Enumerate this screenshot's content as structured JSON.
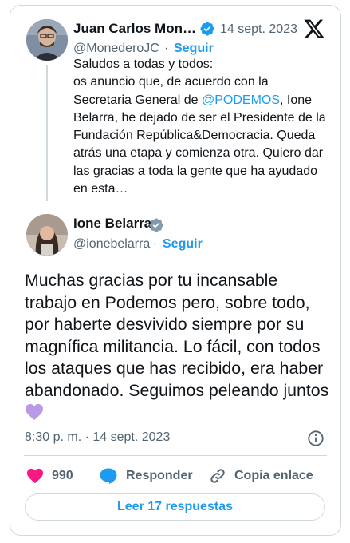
{
  "quoted_tweet": {
    "author_name": "Juan Carlos Mon…",
    "handle": "@MonederoJC",
    "date": "14 sept. 2023",
    "follow_label": "Seguir",
    "separator": "·",
    "text_line1": "Saludos a todas y todos:",
    "text_line2": "os anuncio que, de acuerdo con la",
    "text_line3_pre": "Secretaria General de ",
    "text_mention": "@PODEMOS",
    "text_line3_post": ", Ione",
    "text_rest": "Belarra, he dejado de ser el Presidente de la Fundación República&Democracia. Queda atrás una etapa y comienza otra. Quiero dar las gracias a toda la gente que ha ayudado en esta…"
  },
  "main_tweet": {
    "author_name": "Ione Belarra",
    "handle": "@ionebelarra",
    "follow_label": "Seguir",
    "separator": "·",
    "text": "Muchas gracias por tu incansable trabajo en Podemos pero, sobre todo, por haberte desvivido siempre por su magnífica militancia. Lo fácil, con todos los ataques que has recibido, era haber abandonado. Seguimos peleando juntos",
    "timestamp": "8:30 p. m. · 14 sept. 2023"
  },
  "actions": {
    "likes_count": "990",
    "reply_label": "Responder",
    "copy_label": "Copia enlace"
  },
  "read_replies_label": "Leer 17 respuestas",
  "icons": {
    "brand": "x-logo-icon",
    "verified": "verified-badge-icon",
    "like": "heart-icon",
    "reply": "reply-bubble-icon",
    "copy": "link-icon",
    "info": "info-icon",
    "emoji": "purple-heart-emoji"
  },
  "colors": {
    "accent": "#1d9bf0",
    "like": "#f91880",
    "text": "#0f1419",
    "muted": "#536471",
    "border": "#cfd9de",
    "emoji": "#b89ae6"
  }
}
